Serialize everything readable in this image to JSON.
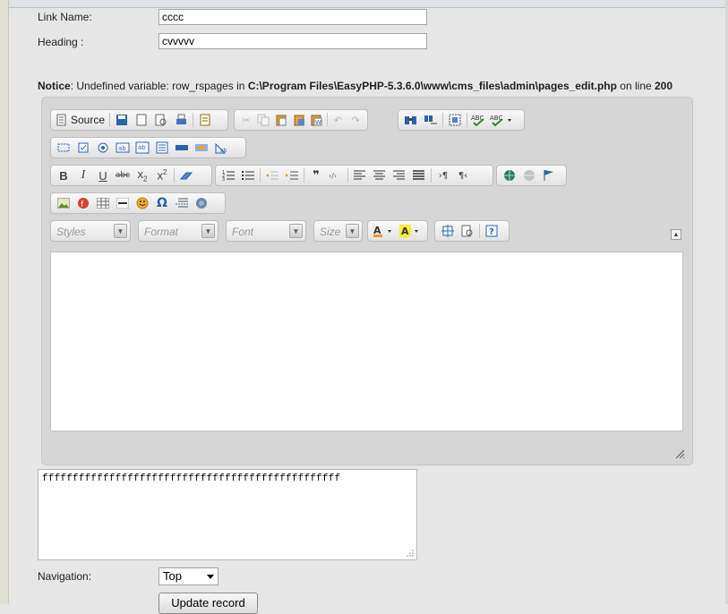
{
  "form": {
    "link_name_label": "Link Name:",
    "link_name_value": "cccc",
    "heading_label": "Heading :",
    "heading_value": "cvvvvv",
    "navigation_label": "Navigation:",
    "navigation_value": "Top",
    "update_button": "Update record"
  },
  "notice": {
    "prefix": "Notice",
    "message": ": Undefined variable: row_rspages in ",
    "path": "C:\\Program Files\\EasyPHP-5.3.6.0\\www\\cms_files\\admin\\pages_edit.php",
    "mid": " on line ",
    "line": "200"
  },
  "editor": {
    "source_label": "Source",
    "styles_placeholder": "Styles",
    "format_placeholder": "Format",
    "font_placeholder": "Font",
    "size_placeholder": "Size",
    "icons": {
      "source": "source-icon",
      "save": "save-icon",
      "new_page": "new-page-icon",
      "preview": "preview-icon",
      "print": "print-icon",
      "templates": "templates-icon",
      "cut": "cut-icon",
      "copy": "copy-icon",
      "paste": "paste-icon",
      "paste_text": "paste-text-icon",
      "paste_word": "paste-word-icon",
      "undo": "undo-icon",
      "redo": "redo-icon",
      "find": "find-icon",
      "replace": "replace-icon",
      "select_all": "select-all-icon",
      "spellcheck": "spellcheck-icon",
      "scayt": "scayt-icon"
    }
  },
  "textarea": {
    "value": "fffffffffffffffffffffffffffffffffffffffffffffffff"
  },
  "colors": {
    "page_bg": "#e6e6e6",
    "toolbar_bg": "#d6d6d6",
    "accent_blue": "#2a62b0"
  }
}
